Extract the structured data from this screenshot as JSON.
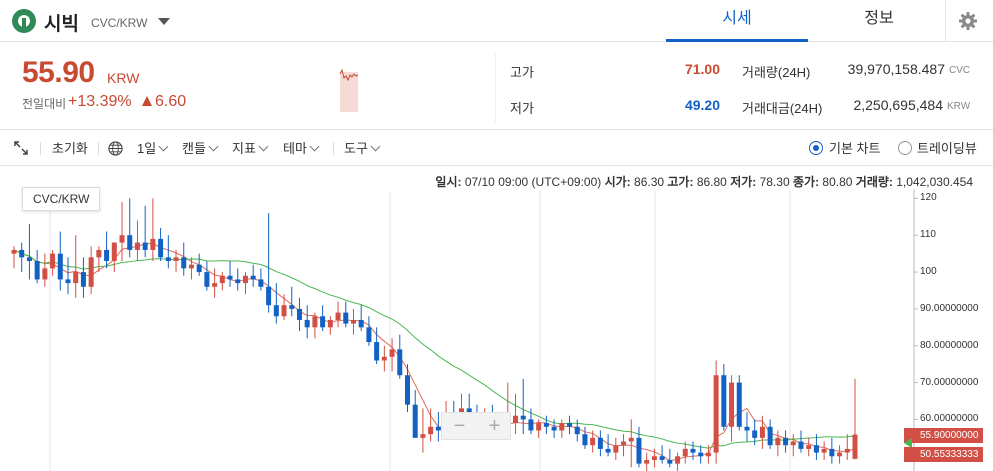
{
  "header": {
    "coin_name": "시빅",
    "pair": "CVC/KRW",
    "tabs": [
      {
        "label": "시세",
        "active": true
      },
      {
        "label": "정보",
        "active": false
      }
    ]
  },
  "summary": {
    "price": "55.90",
    "unit": "KRW",
    "change_label": "전일대비",
    "change_pct": "+13.39%",
    "change_amount": "6.60",
    "high_label": "고가",
    "high_value": "71.00",
    "low_label": "저가",
    "low_value": "49.20",
    "volume_label": "거래량(24H)",
    "volume_value": "39,970,158.487",
    "volume_unit": "CVC",
    "amount_label": "거래대금(24H)",
    "amount_value": "2,250,695,484",
    "amount_unit": "KRW"
  },
  "toolbar": {
    "reset": "초기화",
    "interval": "1일",
    "candle": "캔들",
    "indicator": "지표",
    "theme": "테마",
    "tools": "도구",
    "basic_chart": "기본 차트",
    "tradingview": "트레이딩뷰"
  },
  "chart": {
    "pair_tag": "CVC/KRW",
    "ohlc": {
      "date_label": "일시:",
      "date_value": "07/10 09:00 (UTC+09:00)",
      "open_label": "시가:",
      "open_value": "86.30",
      "high_label": "고가:",
      "high_value": "86.80",
      "low_label": "저가:",
      "low_value": "78.30",
      "close_label": "종가:",
      "close_value": "80.80",
      "volume_label": "거래량:",
      "volume_value": "1,042,030.454"
    },
    "y_axis_labels": [
      "120",
      "110",
      "100",
      "90.00000000",
      "80.00000000",
      "70.00000000",
      "60.00000000"
    ],
    "price_tags": [
      {
        "label": "55.90000000",
        "color": "#d24f45"
      },
      {
        "label": "50.55333333",
        "color": "#d24f45"
      }
    ],
    "zoom_minus": "−",
    "zoom_plus": "+"
  },
  "colors": {
    "up": "#c84a31",
    "down": "#1261c4",
    "candle_up": "#d24f45",
    "candle_down": "#1261c4",
    "ma_short": "#e06b5b",
    "ma_long": "#47b84f",
    "accent": "#1261c4"
  },
  "chart_data": {
    "type": "candlestick",
    "ylim": [
      46,
      122
    ],
    "y_ticks": [
      60,
      70,
      80,
      90,
      100,
      110,
      120
    ],
    "candles": [
      [
        105,
        107,
        101,
        106
      ],
      [
        106,
        108,
        100,
        104
      ],
      [
        104,
        113,
        98,
        103
      ],
      [
        103,
        106,
        97,
        98
      ],
      [
        98,
        105,
        96,
        101
      ],
      [
        101,
        106,
        99,
        105
      ],
      [
        105,
        111,
        95,
        98
      ],
      [
        98,
        104,
        94,
        97
      ],
      [
        97,
        110,
        93,
        100
      ],
      [
        100,
        104,
        93,
        96
      ],
      [
        96,
        107,
        94,
        104
      ],
      [
        104,
        107,
        100,
        106
      ],
      [
        106,
        111,
        101,
        103
      ],
      [
        103,
        108,
        100,
        108
      ],
      [
        108,
        119,
        103,
        110
      ],
      [
        110,
        120,
        104,
        106
      ],
      [
        106,
        114,
        103,
        108
      ],
      [
        108,
        118,
        104,
        106
      ],
      [
        106,
        120,
        103,
        109
      ],
      [
        109,
        112,
        103,
        104
      ],
      [
        104,
        110,
        101,
        103
      ],
      [
        103,
        106,
        100,
        104
      ],
      [
        104,
        108,
        99,
        101
      ],
      [
        101,
        104,
        98,
        102
      ],
      [
        102,
        105,
        99,
        100
      ],
      [
        100,
        103,
        95,
        96
      ],
      [
        96,
        101,
        93,
        97
      ],
      [
        97,
        100,
        95,
        99
      ],
      [
        99,
        103,
        96,
        98
      ],
      [
        98,
        101,
        95,
        97
      ],
      [
        97,
        100,
        94,
        99
      ],
      [
        99,
        102,
        96,
        98
      ],
      [
        98,
        101,
        95,
        96
      ],
      [
        96,
        116,
        89,
        91
      ],
      [
        91,
        97,
        86,
        88
      ],
      [
        88,
        94,
        87,
        91
      ],
      [
        91,
        96,
        88,
        90
      ],
      [
        90,
        93,
        84,
        87
      ],
      [
        87,
        91,
        82,
        85
      ],
      [
        85,
        89,
        82,
        88
      ],
      [
        88,
        91,
        84,
        85
      ],
      [
        85,
        88,
        83,
        87
      ],
      [
        87,
        92,
        85,
        89
      ],
      [
        89,
        92,
        85,
        86
      ],
      [
        86,
        90,
        83,
        87
      ],
      [
        87,
        91,
        84,
        85
      ],
      [
        85,
        88,
        80,
        81
      ],
      [
        81,
        85,
        75,
        76
      ],
      [
        76,
        80,
        73,
        77
      ],
      [
        77,
        82,
        73,
        79
      ],
      [
        79,
        83,
        71,
        72
      ],
      [
        72,
        75,
        62,
        64
      ],
      [
        64,
        68,
        58,
        55
      ],
      [
        55,
        63,
        51,
        56
      ],
      [
        56,
        63,
        54,
        58
      ],
      [
        58,
        62,
        54,
        57
      ],
      [
        57,
        65,
        55,
        62
      ],
      [
        62,
        65,
        58,
        60
      ],
      [
        60,
        67,
        57,
        63
      ],
      [
        63,
        67,
        56,
        61
      ],
      [
        61,
        64,
        57,
        58
      ],
      [
        58,
        63,
        55,
        61
      ],
      [
        61,
        64,
        57,
        58
      ],
      [
        58,
        62,
        55,
        57
      ],
      [
        57,
        70,
        55,
        59
      ],
      [
        59,
        67,
        56,
        61
      ],
      [
        61,
        71,
        56,
        60
      ],
      [
        60,
        63,
        56,
        57
      ],
      [
        57,
        60,
        55,
        59
      ],
      [
        59,
        61,
        56,
        58
      ],
      [
        58,
        60,
        55,
        57
      ],
      [
        57,
        60,
        55,
        59
      ],
      [
        59,
        61,
        56,
        58
      ],
      [
        58,
        60,
        54,
        56
      ],
      [
        56,
        58,
        52,
        53
      ],
      [
        53,
        57,
        51,
        55
      ],
      [
        55,
        57,
        50,
        52
      ],
      [
        52,
        56,
        50,
        51
      ],
      [
        51,
        55,
        49,
        53
      ],
      [
        53,
        56,
        50,
        54
      ],
      [
        54,
        60,
        47,
        55
      ],
      [
        55,
        58,
        47,
        48
      ],
      [
        48,
        51,
        46,
        49
      ],
      [
        49,
        52,
        47,
        50
      ],
      [
        50,
        53,
        48,
        49
      ],
      [
        49,
        52,
        47,
        48
      ],
      [
        48,
        51,
        46,
        50
      ],
      [
        50,
        54,
        48,
        52
      ],
      [
        52,
        54,
        49,
        51
      ],
      [
        51,
        53,
        48,
        50
      ],
      [
        50,
        53,
        48,
        51
      ],
      [
        51,
        76,
        48,
        72
      ],
      [
        72,
        75,
        57,
        58
      ],
      [
        58,
        72,
        54,
        70
      ],
      [
        70,
        72,
        57,
        58
      ],
      [
        58,
        62,
        54,
        57
      ],
      [
        57,
        60,
        53,
        55
      ],
      [
        55,
        61,
        52,
        58
      ],
      [
        58,
        60,
        52,
        53
      ],
      [
        53,
        57,
        50,
        55
      ],
      [
        55,
        57,
        51,
        53
      ],
      [
        53,
        56,
        50,
        54
      ],
      [
        54,
        57,
        51,
        52
      ],
      [
        52,
        55,
        50,
        53
      ],
      [
        53,
        56,
        49,
        51
      ],
      [
        51,
        54,
        49,
        52
      ],
      [
        52,
        55,
        48,
        50
      ],
      [
        50,
        53,
        48,
        51
      ],
      [
        51,
        56,
        49,
        52
      ],
      [
        49.3,
        71,
        49.2,
        55.9
      ]
    ]
  }
}
